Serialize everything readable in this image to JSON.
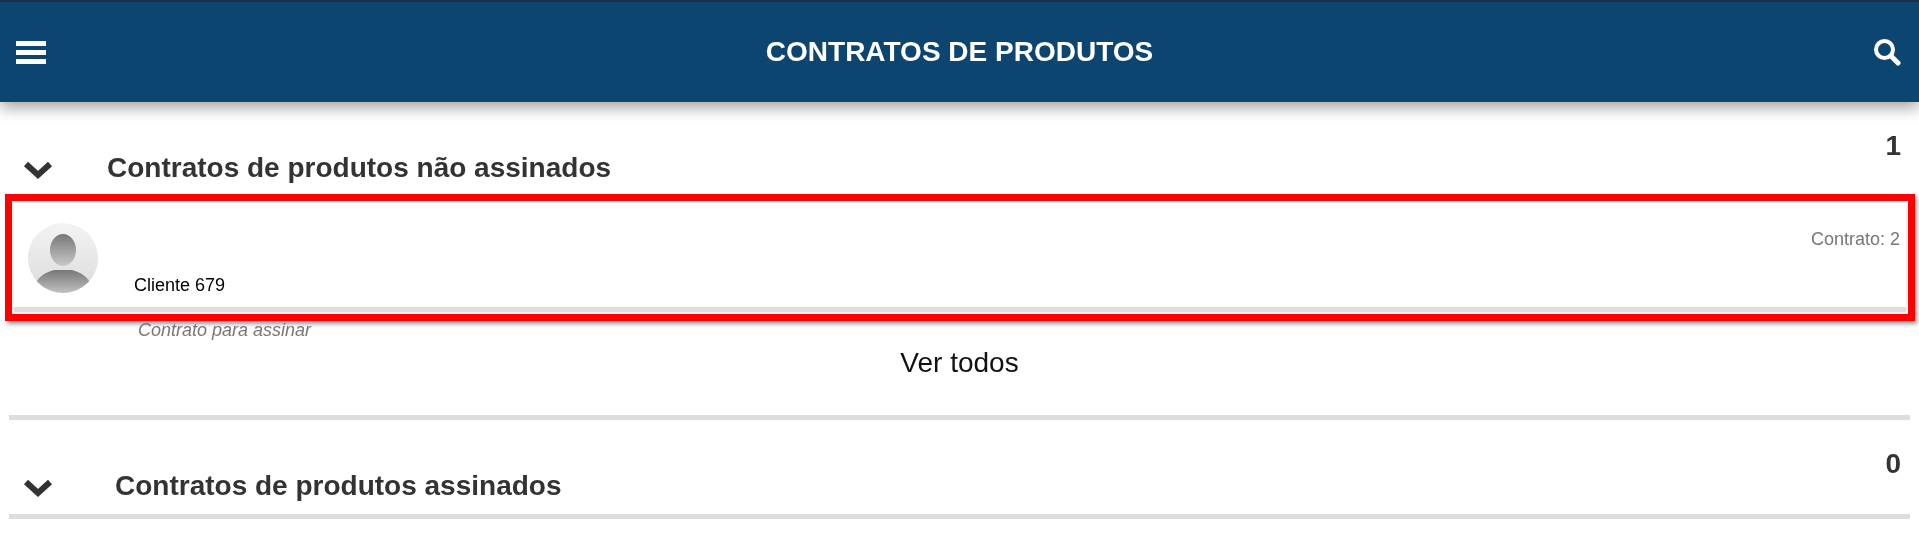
{
  "header": {
    "title": "CONTRATOS DE PRODUTOS"
  },
  "sections": [
    {
      "title": "Contratos de produtos não assinados",
      "count": "1",
      "expanded": true,
      "items": [
        {
          "client": "Cliente 679",
          "contract": "Contrato: 2",
          "status": "Contrato para assinar",
          "highlighted": true
        }
      ],
      "more": "Ver todos"
    },
    {
      "title": "Contratos de produtos assinados",
      "count": "0",
      "expanded": true
    }
  ]
}
